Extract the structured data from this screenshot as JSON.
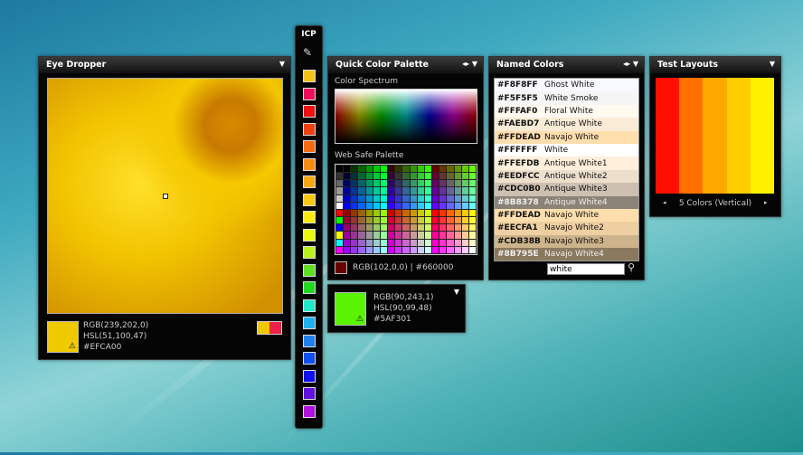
{
  "eye_dropper": {
    "title": "Eye Dropper",
    "rgb": "RGB(239,202,0)",
    "hsl": "HSL(51,100,47)",
    "hex": "#EFCA00",
    "swatch": "#efca00",
    "mini": [
      "#efca00",
      "#f0204a"
    ]
  },
  "toolbar": {
    "title": "ICP",
    "swatches": [
      "#f2c418",
      "#f0105a",
      "#f01010",
      "#f04010",
      "#f86a10",
      "#f88c10",
      "#f8a810",
      "#f8c810",
      "#f8e810",
      "#e8f810",
      "#b8f020",
      "#60e020",
      "#20d820",
      "#20e8c8",
      "#20b0f0",
      "#2080f0",
      "#1050f0",
      "#1010f0",
      "#6010e0",
      "#b010e0"
    ]
  },
  "quick_palette": {
    "title": "Quick Color Palette",
    "spectrum_label": "Color Spectrum",
    "websafe_label": "Web Safe Palette",
    "selected_text": "RGB(102,0,0) | #660000",
    "selected_color": "#660000"
  },
  "picked": {
    "rgb": "RGB(90,243,1)",
    "hsl": "HSL(90,99,48)",
    "hex": "#5AF301",
    "color": "#5af301"
  },
  "named_colors": {
    "title": "Named Colors",
    "search_value": "white",
    "rows": [
      {
        "hex": "#F8F8FF",
        "name": "Ghost White",
        "color": "#f8f8ff"
      },
      {
        "hex": "#F5F5F5",
        "name": "White Smoke",
        "color": "#f5f5f5"
      },
      {
        "hex": "#FFFAF0",
        "name": "Floral White",
        "color": "#fffaf0"
      },
      {
        "hex": "#FAEBD7",
        "name": "Antique White",
        "color": "#faebd7"
      },
      {
        "hex": "#FFDEAD",
        "name": "Navajo White",
        "color": "#ffdead"
      },
      {
        "hex": "#FFFFFF",
        "name": "White",
        "color": "#ffffff"
      },
      {
        "hex": "#FFEFDB",
        "name": "Antique White1",
        "color": "#ffefdb"
      },
      {
        "hex": "#EEDFCC",
        "name": "Antique White2",
        "color": "#eedfcc"
      },
      {
        "hex": "#CDC0B0",
        "name": "Antique White3",
        "color": "#cdc0b0"
      },
      {
        "hex": "#8B8378",
        "name": "Antique White4",
        "color": "#8b8378"
      },
      {
        "hex": "#FFDEAD",
        "name": "Navajo White",
        "color": "#ffdead"
      },
      {
        "hex": "#EECFA1",
        "name": "Navajo White2",
        "color": "#eecfa1"
      },
      {
        "hex": "#CDB38B",
        "name": "Navajo White3",
        "color": "#cdb38b"
      },
      {
        "hex": "#8B795E",
        "name": "Navajo White4",
        "color": "#8b795e"
      }
    ]
  },
  "test_layouts": {
    "title": "Test Layouts",
    "caption": "5 Colors (Vertical)",
    "stripes": [
      "#ff1000",
      "#ff7000",
      "#ffa800",
      "#ffcc00",
      "#fff000"
    ]
  }
}
